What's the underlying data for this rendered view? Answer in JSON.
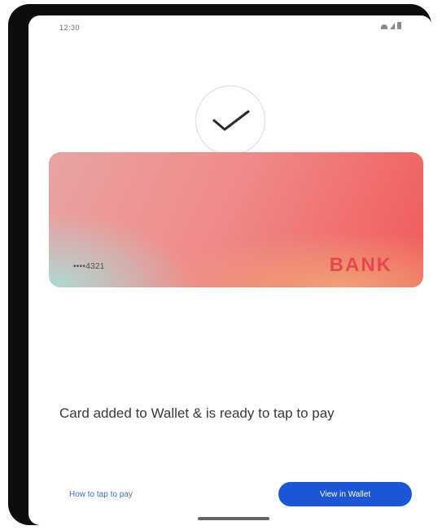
{
  "status_bar": {
    "time": "12:30",
    "icons": [
      "wifi-icon",
      "signal-icon",
      "battery-icon"
    ]
  },
  "success": {
    "icon": "checkmark-icon"
  },
  "card": {
    "number": "••••4321",
    "bank_name": "BANK",
    "colors": {
      "gradient_start": "#e9a3a3",
      "gradient_end": "#f05a59",
      "teal_accent": "#aadfd7",
      "bank_text": "#e5484d"
    }
  },
  "message": "Card added to Wallet & is ready to tap to pay",
  "actions": {
    "secondary_label": "How to tap to pay",
    "primary_label": "View in Wallet",
    "primary_color": "#1a56d6"
  }
}
